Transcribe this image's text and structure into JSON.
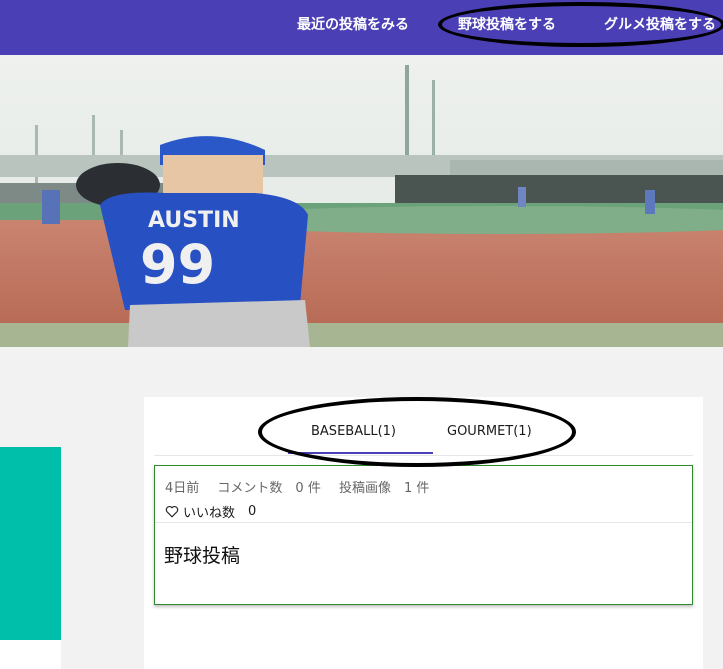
{
  "nav": {
    "recent": "最近の投稿をみる",
    "baseball_post": "野球投稿をする",
    "gourmet_post": "グルメ投稿をする"
  },
  "hero": {
    "jersey_name": "AUSTIN",
    "jersey_number": "99"
  },
  "tabs": [
    {
      "label": "BASEBALL(1)",
      "active": true
    },
    {
      "label": "GOURMET(1)",
      "active": false
    }
  ],
  "post": {
    "time": "4日前",
    "comments": "コメント数　0 件",
    "images": "投稿画像　1 件",
    "likes_label": "いいね数",
    "likes_count": "0",
    "title": "野球投稿"
  },
  "colors": {
    "nav_bg": "#4a3fb4",
    "teal": "#00bfaa",
    "card_border": "#2e8b2e"
  }
}
